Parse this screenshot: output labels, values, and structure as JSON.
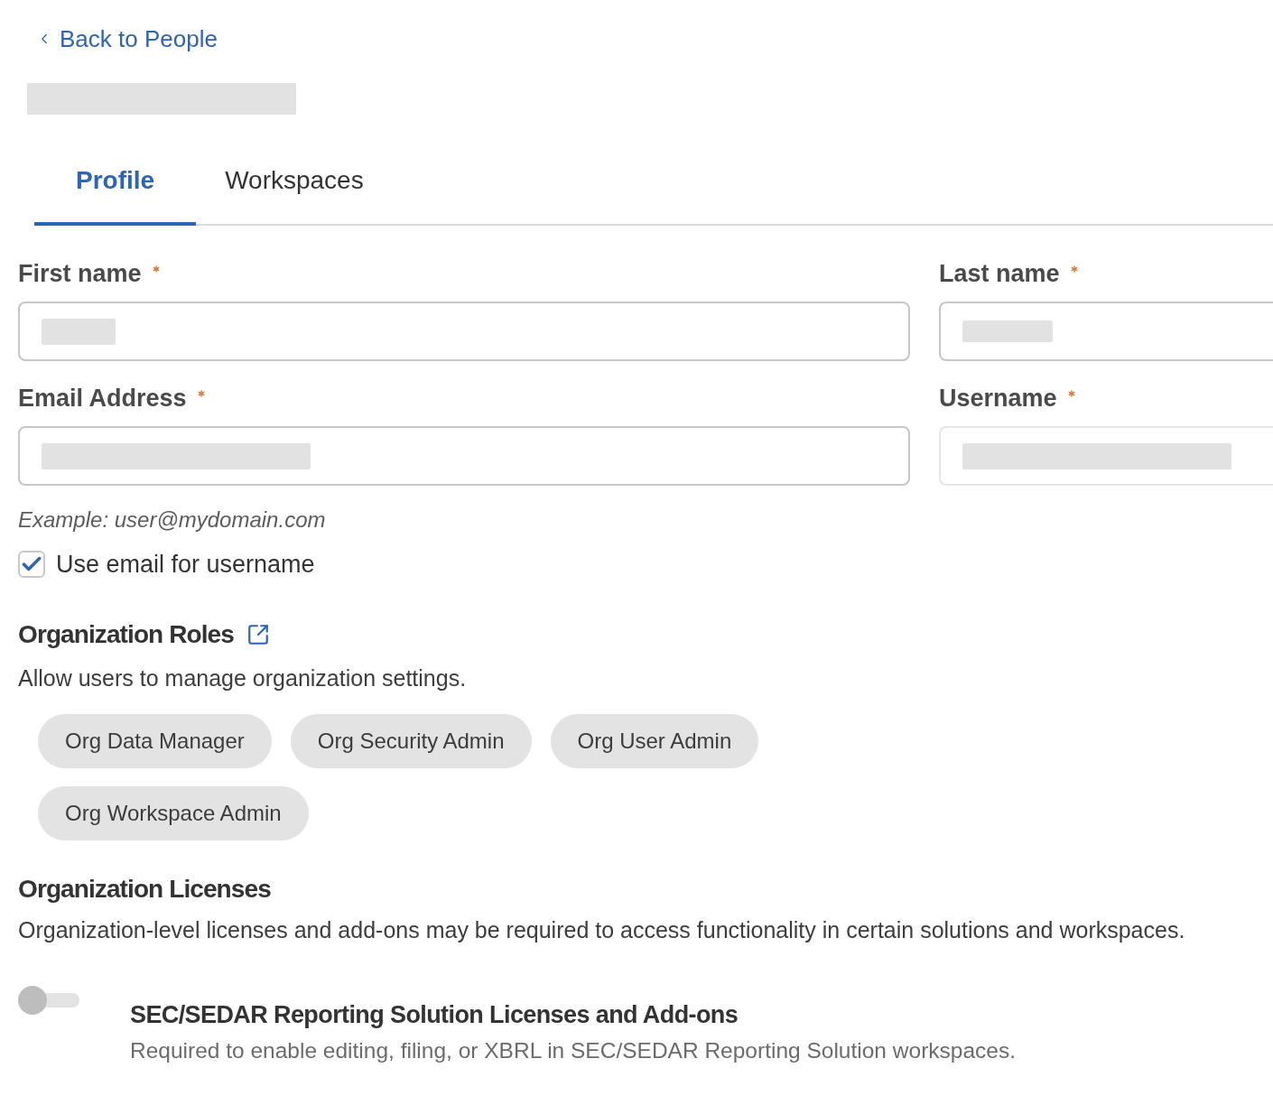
{
  "back_link": {
    "label": "Back to People"
  },
  "page_title": {
    "redacted": true
  },
  "tabs": [
    {
      "label": "Profile",
      "selected": true
    },
    {
      "label": "Workspaces",
      "selected": false
    }
  ],
  "fields": [
    {
      "label": "First name",
      "required": true,
      "value_redacted": true,
      "disabled": false
    },
    {
      "label": "Last name",
      "required": true,
      "value_redacted": true,
      "disabled": false
    },
    {
      "label": "Email Address",
      "required": true,
      "value_redacted": true,
      "disabled": false,
      "hint": "Example: user@mydomain.com"
    },
    {
      "label": "Username",
      "required": true,
      "value_redacted": true,
      "disabled": true
    }
  ],
  "username_checkbox": {
    "label": "Use email for username",
    "checked": true
  },
  "roles_section": {
    "title": "Organization Roles",
    "description": "Allow users to manage organization settings.",
    "roles": [
      {
        "label": "Org Data Manager",
        "selected": false
      },
      {
        "label": "Org Security Admin",
        "selected": false
      },
      {
        "label": "Org User Admin",
        "selected": false
      },
      {
        "label": "Org Workspace Admin",
        "selected": false
      }
    ]
  },
  "licenses_section": {
    "title": "Organization Licenses",
    "description": "Organization-level licenses and add-ons may be required to access functionality in certain solutions and workspaces.",
    "items": [
      {
        "title": "SEC/SEDAR Reporting Solution Licenses and Add-ons",
        "description": "Required to enable editing, filing, or XBRL in SEC/SEDAR Reporting Solution workspaces.",
        "on": false
      }
    ]
  }
}
